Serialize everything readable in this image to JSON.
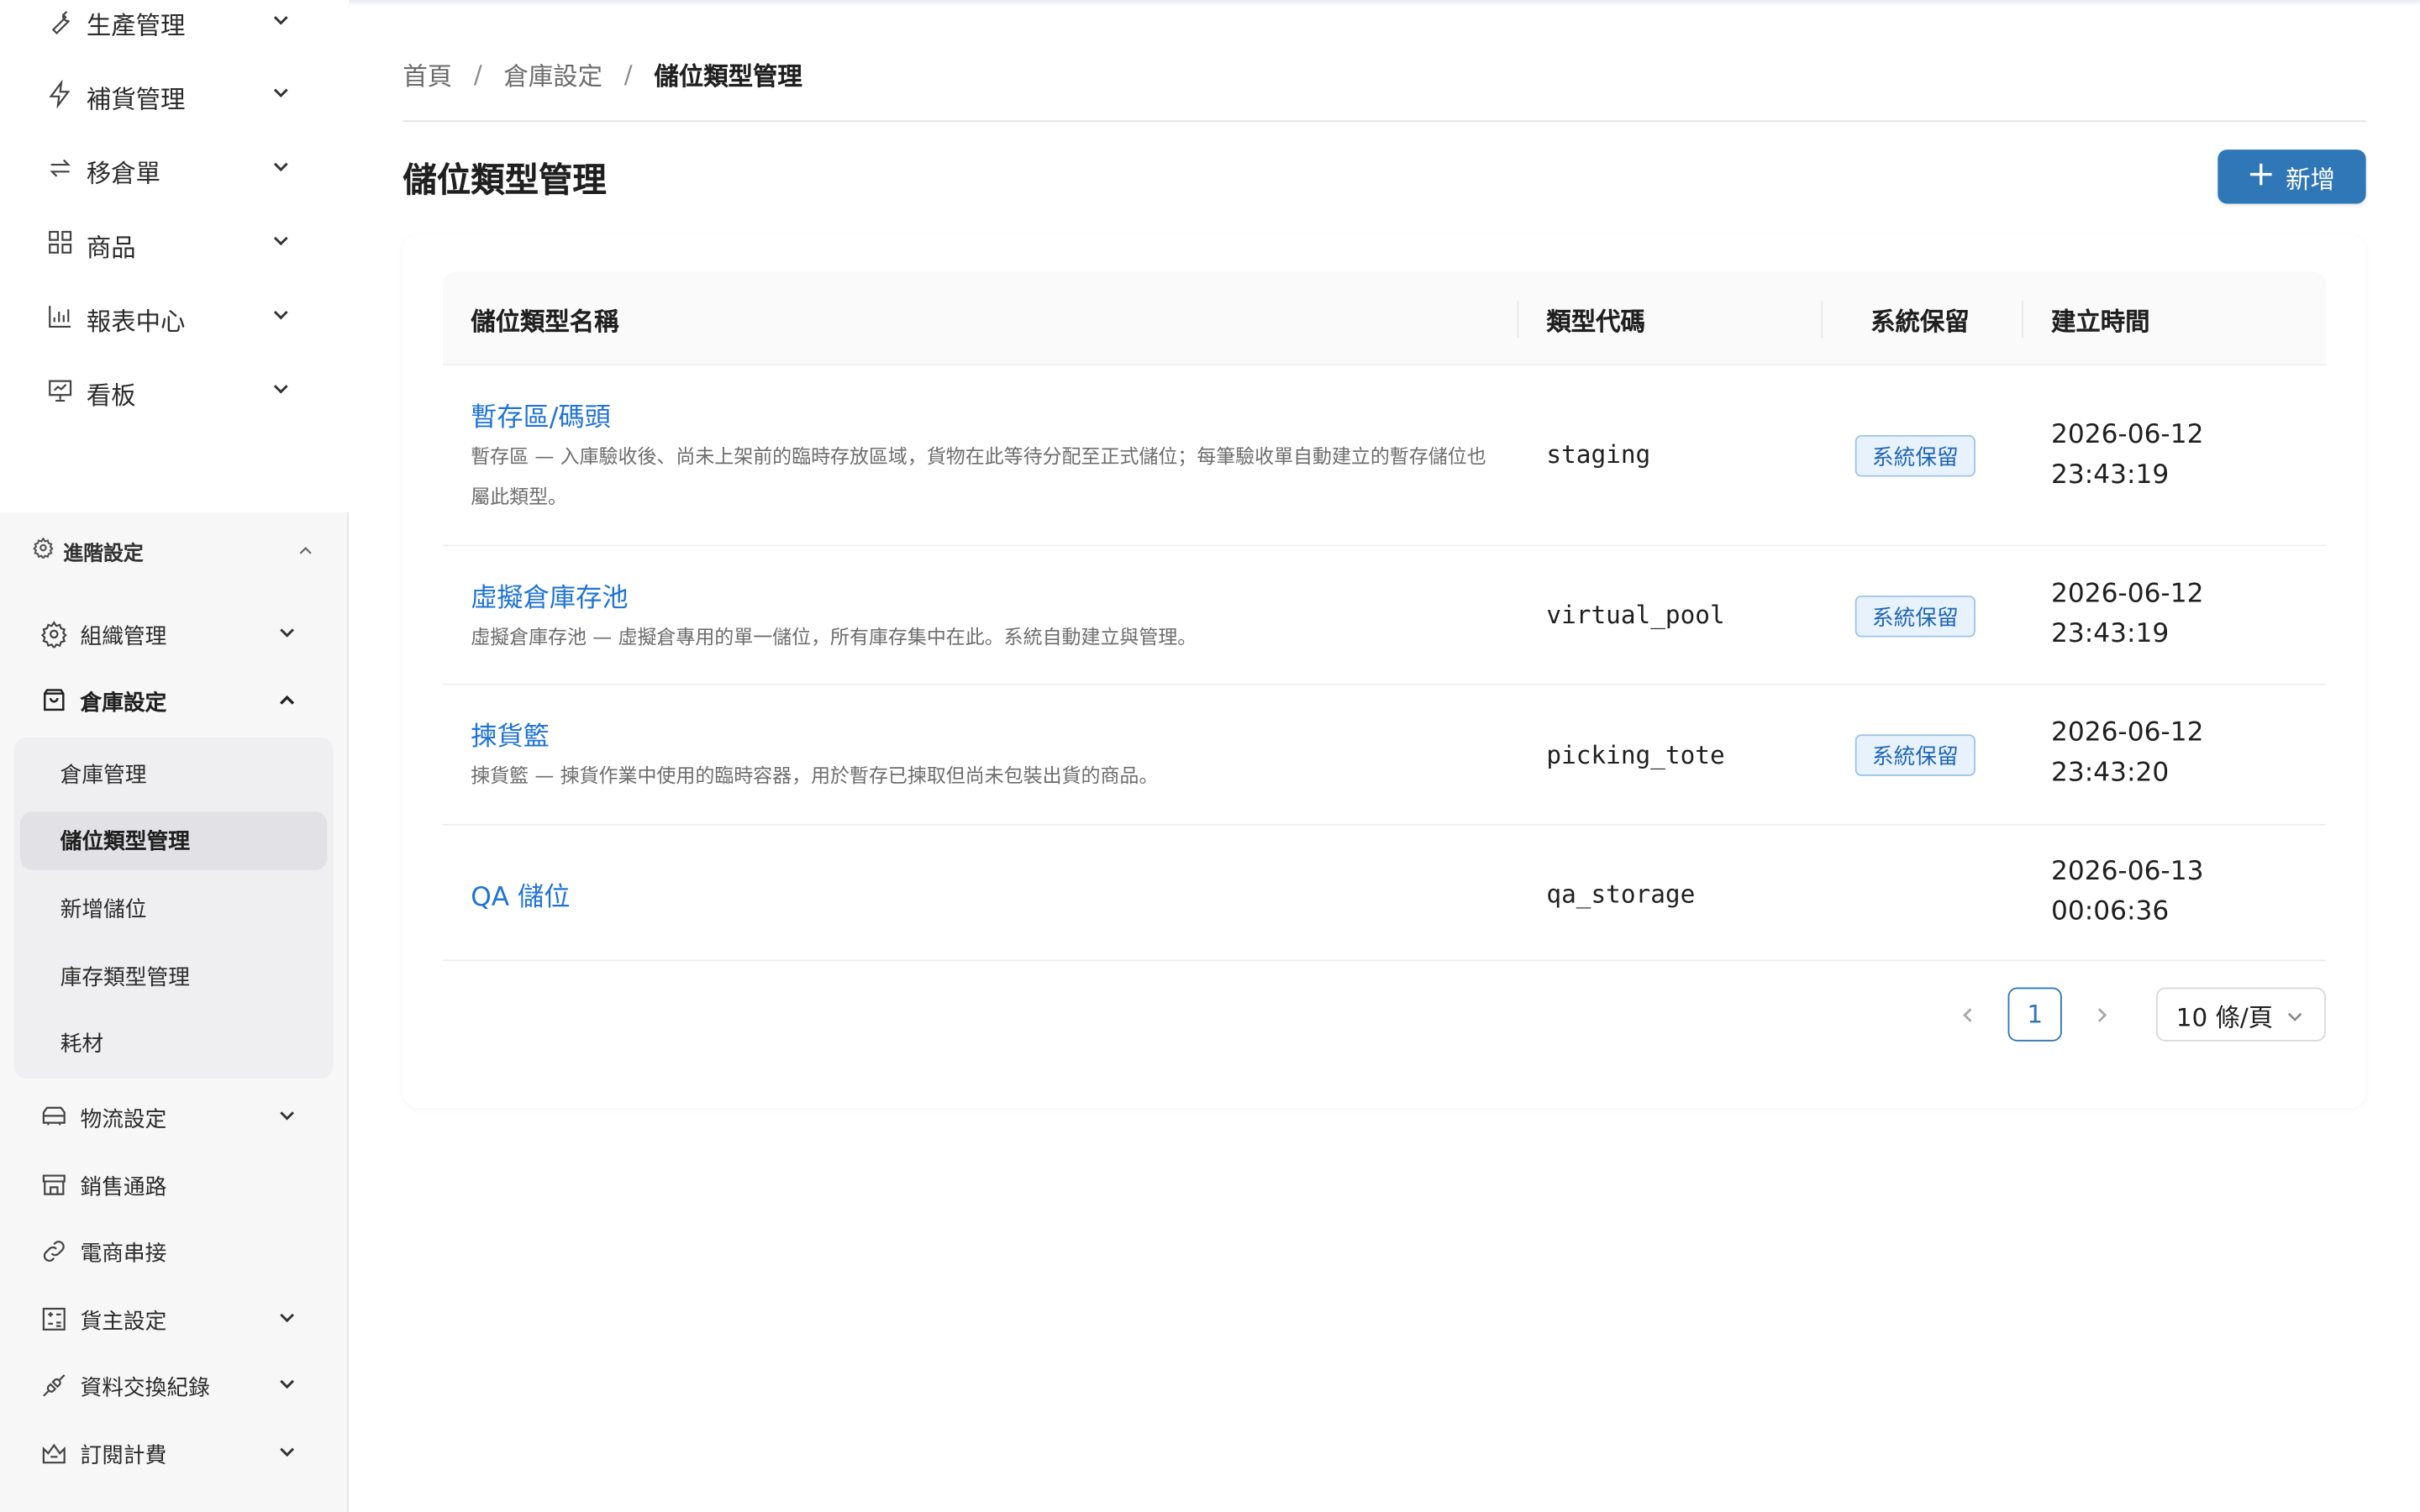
{
  "sidebar": {
    "top_items": [
      {
        "label": "生產管理",
        "icon": "wrench-icon"
      },
      {
        "label": "補貨管理",
        "icon": "lightning-icon"
      },
      {
        "label": "移倉單",
        "icon": "transfer-icon"
      },
      {
        "label": "商品",
        "icon": "grid-icon"
      },
      {
        "label": "報表中心",
        "icon": "bar-chart-icon"
      },
      {
        "label": "看板",
        "icon": "dashboard-icon"
      }
    ],
    "section": {
      "label": "進階設定",
      "icon": "gear-icon"
    },
    "advanced_items": [
      {
        "label": "組織管理",
        "icon": "gear-icon"
      },
      {
        "label": "倉庫設定",
        "icon": "inbox-icon"
      },
      {
        "label": "物流設定",
        "icon": "truck-icon"
      },
      {
        "label": "銷售通路",
        "icon": "store-icon"
      },
      {
        "label": "電商串接",
        "icon": "link-icon"
      },
      {
        "label": "貨主設定",
        "icon": "calculator-icon"
      },
      {
        "label": "資料交換紀錄",
        "icon": "api-icon"
      },
      {
        "label": "訂閱計費",
        "icon": "crown-icon"
      }
    ],
    "warehouse_sub_items": [
      "倉庫管理",
      "儲位類型管理",
      "新增儲位",
      "庫存類型管理",
      "耗材"
    ]
  },
  "breadcrumb": {
    "home": "首頁",
    "parent": "倉庫設定",
    "current": "儲位類型管理",
    "separator": "/"
  },
  "page": {
    "title": "儲位類型管理",
    "add_label": "新增"
  },
  "table": {
    "headers": {
      "name": "儲位類型名稱",
      "code": "類型代碼",
      "reserved": "系統保留",
      "created": "建立時間"
    },
    "rows": [
      {
        "name": "暫存區/碼頭",
        "description": "暫存區 — 入庫驗收後、尚未上架前的臨時存放區域，貨物在此等待分配至正式儲位；每筆驗收單自動建立的暫存儲位也屬此類型。",
        "code": "staging",
        "reserved": "系統保留",
        "date": "2026-06-12",
        "time": "23:43:19"
      },
      {
        "name": "虛擬倉庫存池",
        "description": "虛擬倉庫存池 — 虛擬倉專用的單一儲位，所有庫存集中在此。系統自動建立與管理。",
        "code": "virtual_pool",
        "reserved": "系統保留",
        "date": "2026-06-12",
        "time": "23:43:19"
      },
      {
        "name": "揀貨籃",
        "description": "揀貨籃 — 揀貨作業中使用的臨時容器，用於暫存已揀取但尚未包裝出貨的商品。",
        "code": "picking_tote",
        "reserved": "系統保留",
        "date": "2026-06-12",
        "time": "23:43:20"
      },
      {
        "name": "QA 儲位",
        "description": "",
        "code": "qa_storage",
        "reserved": "",
        "date": "2026-06-13",
        "time": "00:06:36"
      }
    ]
  },
  "pagination": {
    "current_page": "1",
    "page_size": "10 條/頁"
  },
  "colors": {
    "primary": "#2f77b6",
    "link": "#1f73d6",
    "badge_bg": "#e8f2fc",
    "badge_border": "#9ec3ea"
  }
}
